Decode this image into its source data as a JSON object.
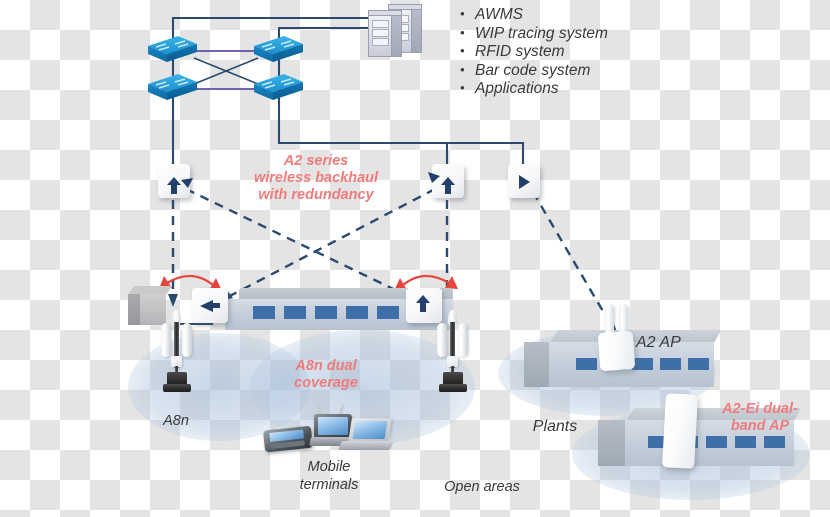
{
  "diagram": {
    "title": "A2 series wireless backhaul network topology",
    "colors": {
      "accent_red": "#ef7c7c",
      "link_blue": "#2b4a6f",
      "link_purple": "#5b4fa8",
      "switch_blue": "#1b8fd0",
      "window_blue": "#3f6fa8",
      "text_gray": "#3a3a3c",
      "coverage_blue": "#9cb6d4"
    },
    "server_systems": [
      "AWMS",
      "WIP tracing system",
      "RFID system",
      "Bar code system",
      "Applications"
    ],
    "annotations": {
      "backhaul": "A2 series\nwireless backhaul\nwith redundancy",
      "backhaul_line1": "A2 series",
      "backhaul_line2": "wireless backhaul",
      "backhaul_line3": "with redundancy",
      "coverage_line1": "A8n dual",
      "coverage_line2": "coverage",
      "dualband_line1": "A2-Ei dual-",
      "dualband_line2": "band AP"
    },
    "labels": {
      "a8n": "A8n",
      "mobile_line1": "Mobile",
      "mobile_line2": "terminals",
      "open_areas": "Open areas",
      "plants": "Plants",
      "a2_ap": "A2 AP"
    },
    "nodes": {
      "switches": [
        "core-switch-1",
        "core-switch-2",
        "core-switch-3",
        "core-switch-4"
      ],
      "backhaul_aps": [
        "backhaul-ap-left",
        "backhaul-ap-center",
        "backhaul-ap-right"
      ],
      "edge_aps": [
        "edge-ap-left",
        "edge-ap-right"
      ],
      "towers": [
        "a8n-tower-left",
        "a8n-tower-right"
      ],
      "buildings": [
        "warehouse",
        "plant-upper",
        "plant-lower",
        "store-left"
      ]
    },
    "counts": {
      "warehouse_windows": 6,
      "plant_upper_windows": 5,
      "plant_lower_windows": 5,
      "core_switches": 4
    }
  }
}
